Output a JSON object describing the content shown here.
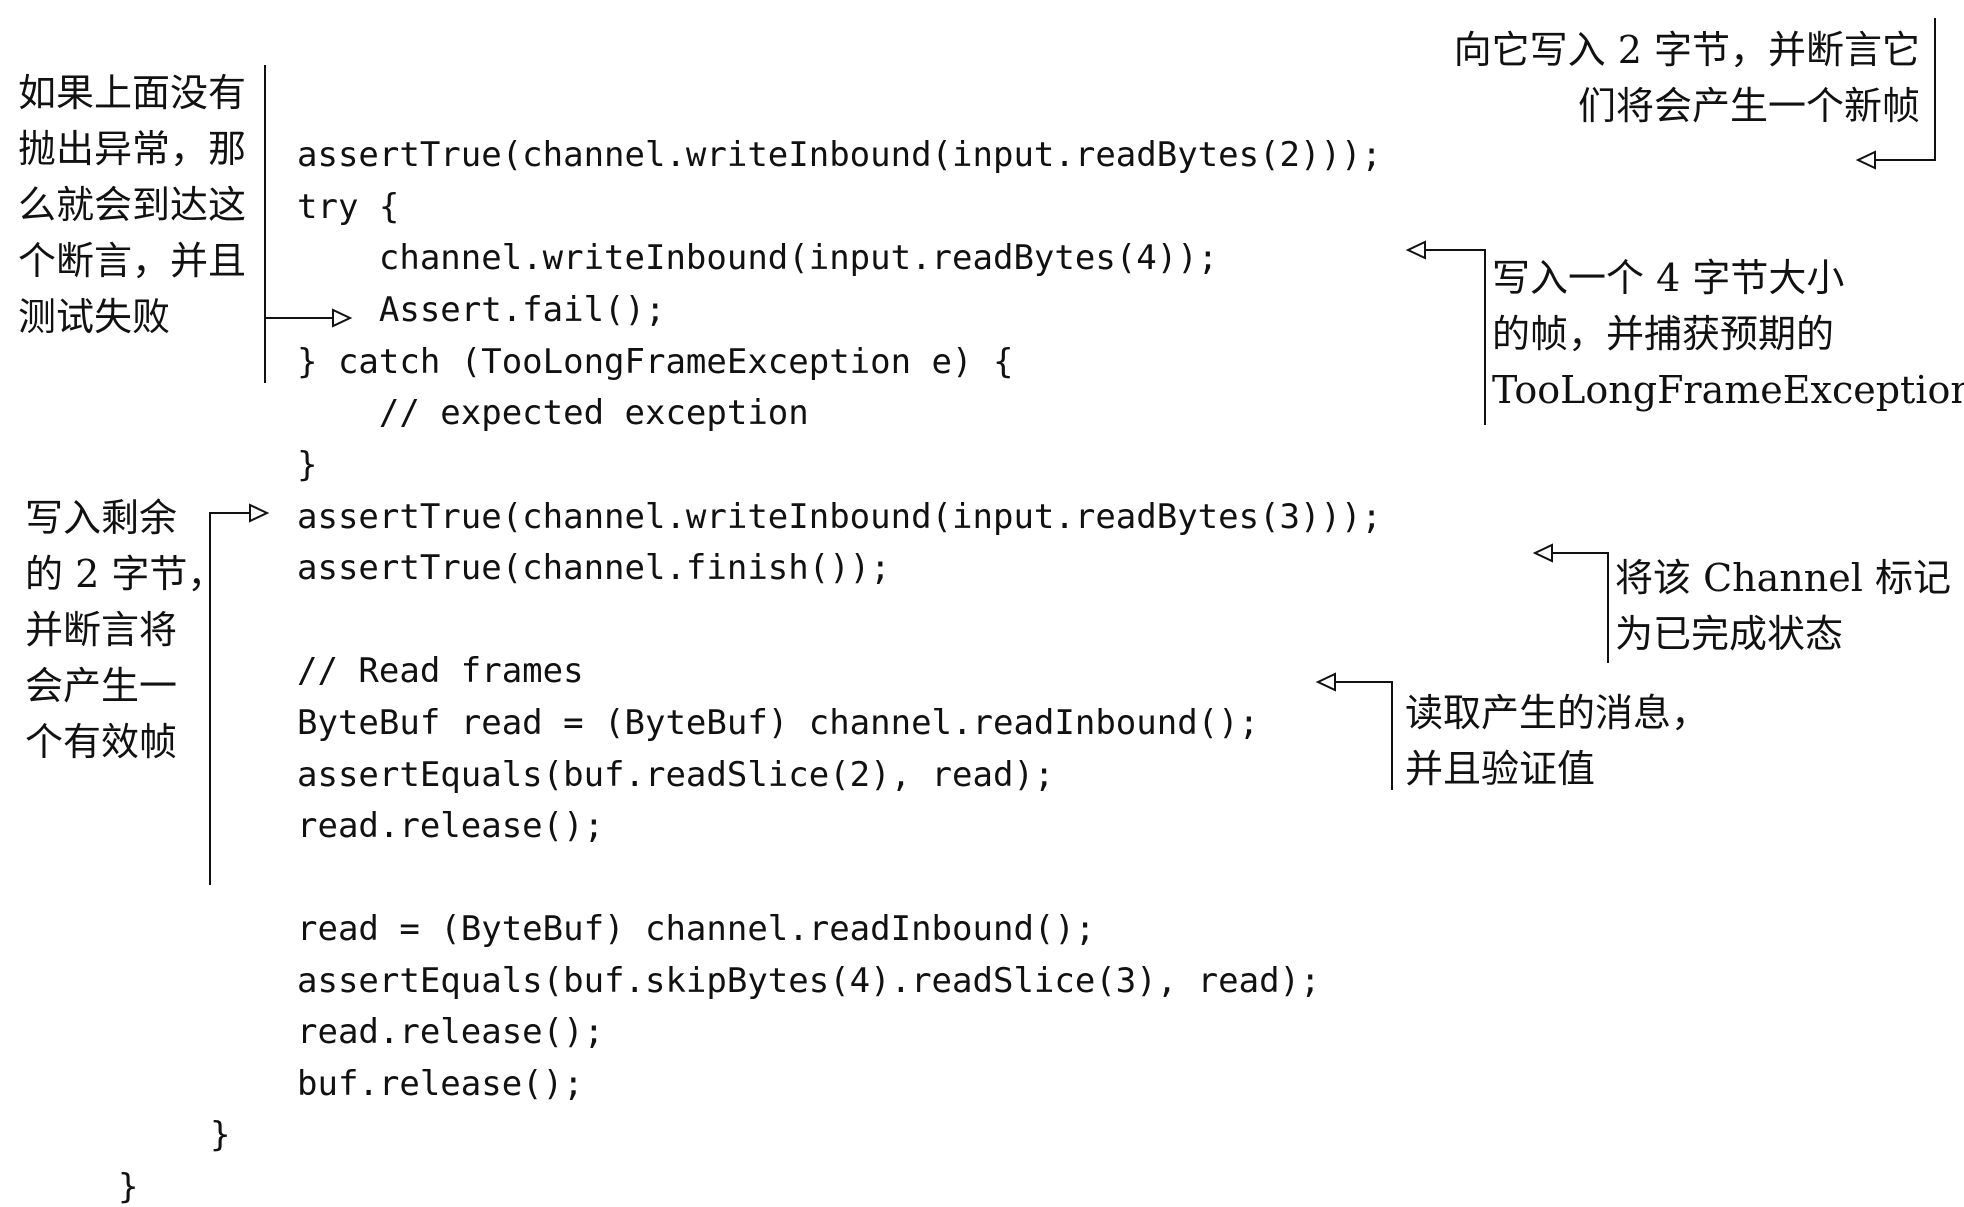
{
  "code": [
    "assertTrue(channel.writeInbound(input.readBytes(2)));",
    "try {",
    "    channel.writeInbound(input.readBytes(4));",
    "    Assert.fail();",
    "} catch (TooLongFrameException e) {",
    "    // expected exception",
    "}",
    "assertTrue(channel.writeInbound(input.readBytes(3)));",
    "assertTrue(channel.finish());",
    "",
    "// Read frames",
    "ByteBuf read = (ByteBuf) channel.readInbound();",
    "assertEquals(buf.readSlice(2), read);",
    "read.release();",
    "",
    "read = (ByteBuf) channel.readInbound();",
    "assertEquals(buf.skipBytes(4).readSlice(3), read);",
    "read.release();",
    "buf.release();",
    "}",
    "}"
  ],
  "annotations": {
    "write_two_bytes": [
      "向它写入 2 字节，并断言它",
      "们将会产生一个新帧"
    ],
    "no_exception_fail": [
      "如果上面没有",
      "抛出异常，那",
      "么就会到达这",
      "个断言，并且",
      "测试失败"
    ],
    "write_four_bytes": [
      "写入一个 4 字节大小",
      "的帧，并捕获预期的",
      "TooLongFrameException"
    ],
    "write_remaining": [
      "写入剩余",
      "的 2 字节，",
      "并断言将",
      "会产生一",
      "个有效帧"
    ],
    "mark_finished": [
      "将该 Channel 标记",
      "为已完成状态"
    ],
    "read_messages": [
      "读取产生的消息，",
      "并且验证值"
    ]
  }
}
